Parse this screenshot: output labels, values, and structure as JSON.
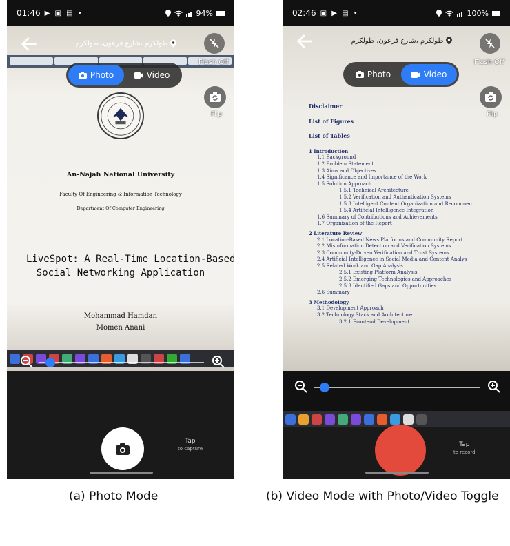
{
  "phone_a": {
    "status": {
      "time": "01:46",
      "notif_icons": "▶ ▣ ▤ •",
      "battery": "94%"
    },
    "location": "طولكرم ،شارع فرعون، طولكرم",
    "mode_toggle": {
      "photo_label": "Photo",
      "video_label": "Video",
      "active": "photo"
    },
    "flash_label": "Flash Off",
    "flip_label": "Flip",
    "document": {
      "university": "An-Najah National University",
      "faculty": "Faculty Of Engineering & Information Technology",
      "department": "Department Of Computer Engineering",
      "title_line1": "LiveSpot: A Real-Time Location-Based",
      "title_line2": "Social Networking Application",
      "author1": "Mohammad Hamdan",
      "author2": "Momen Anani"
    },
    "tap_hint": {
      "main": "Tap",
      "sub": "to capture"
    }
  },
  "phone_b": {
    "status": {
      "time": "02:46",
      "notif_icons": "▣ ▶ ▤ •",
      "battery": "100%"
    },
    "location": "طولكرم ،شارع فرعون، طولكرم",
    "mode_toggle": {
      "photo_label": "Photo",
      "video_label": "Video",
      "active": "video"
    },
    "flash_label": "Flash Off",
    "flip_label": "Flip",
    "toc": {
      "disclaimer": "Disclaimer",
      "figures": "List of Figures",
      "tables": "List of Tables",
      "ch1": "1  Introduction",
      "s1_1": "1.1  Background",
      "s1_2": "1.2  Problem Statement",
      "s1_3": "1.3  Aims and Objectives",
      "s1_4": "1.4  Significance and Importance of the Work",
      "s1_5": "1.5  Solution Approach",
      "s1_5_1": "1.5.1  Technical Architecture",
      "s1_5_2": "1.5.2  Verification and Authentication Systems",
      "s1_5_3": "1.5.3  Intelligent Content Organization and Recommen",
      "s1_5_4": "1.5.4  Artificial Intelligence Integration",
      "s1_6": "1.6  Summary of Contributions and Achievements",
      "s1_7": "1.7  Organization of the Report",
      "ch2": "2  Literature Review",
      "s2_1": "2.1  Location-Based News Platforms and Community Report",
      "s2_2": "2.2  Misinformation Detection and Verification Systems",
      "s2_3": "2.3  Community-Driven Verification and Trust Systems",
      "s2_4": "2.4  Artificial Intelligence in Social Media and Content Analys",
      "s2_5": "2.5  Related Work and Gap Analysis",
      "s2_5_1": "2.5.1  Existing Platform Analysis",
      "s2_5_2": "2.5.2  Emerging Technologies and Approaches",
      "s2_5_3": "2.5.3  Identified Gaps and Opportunities",
      "s2_6": "2.6  Summary",
      "ch3": "3  Methodology",
      "s3_1": "3.1  Development Approach",
      "s3_2": "3.2  Technology Stack and Architecture",
      "s3_2_1": "3.2.1  Frontend Development"
    },
    "tap_hint": {
      "main": "Tap",
      "sub": "to record"
    }
  },
  "captions": {
    "a": "(a) Photo Mode",
    "b": "(b) Video Mode with Photo/Video Toggle"
  },
  "colors": {
    "accent": "#2f7df6",
    "record": "#e34a3b"
  }
}
